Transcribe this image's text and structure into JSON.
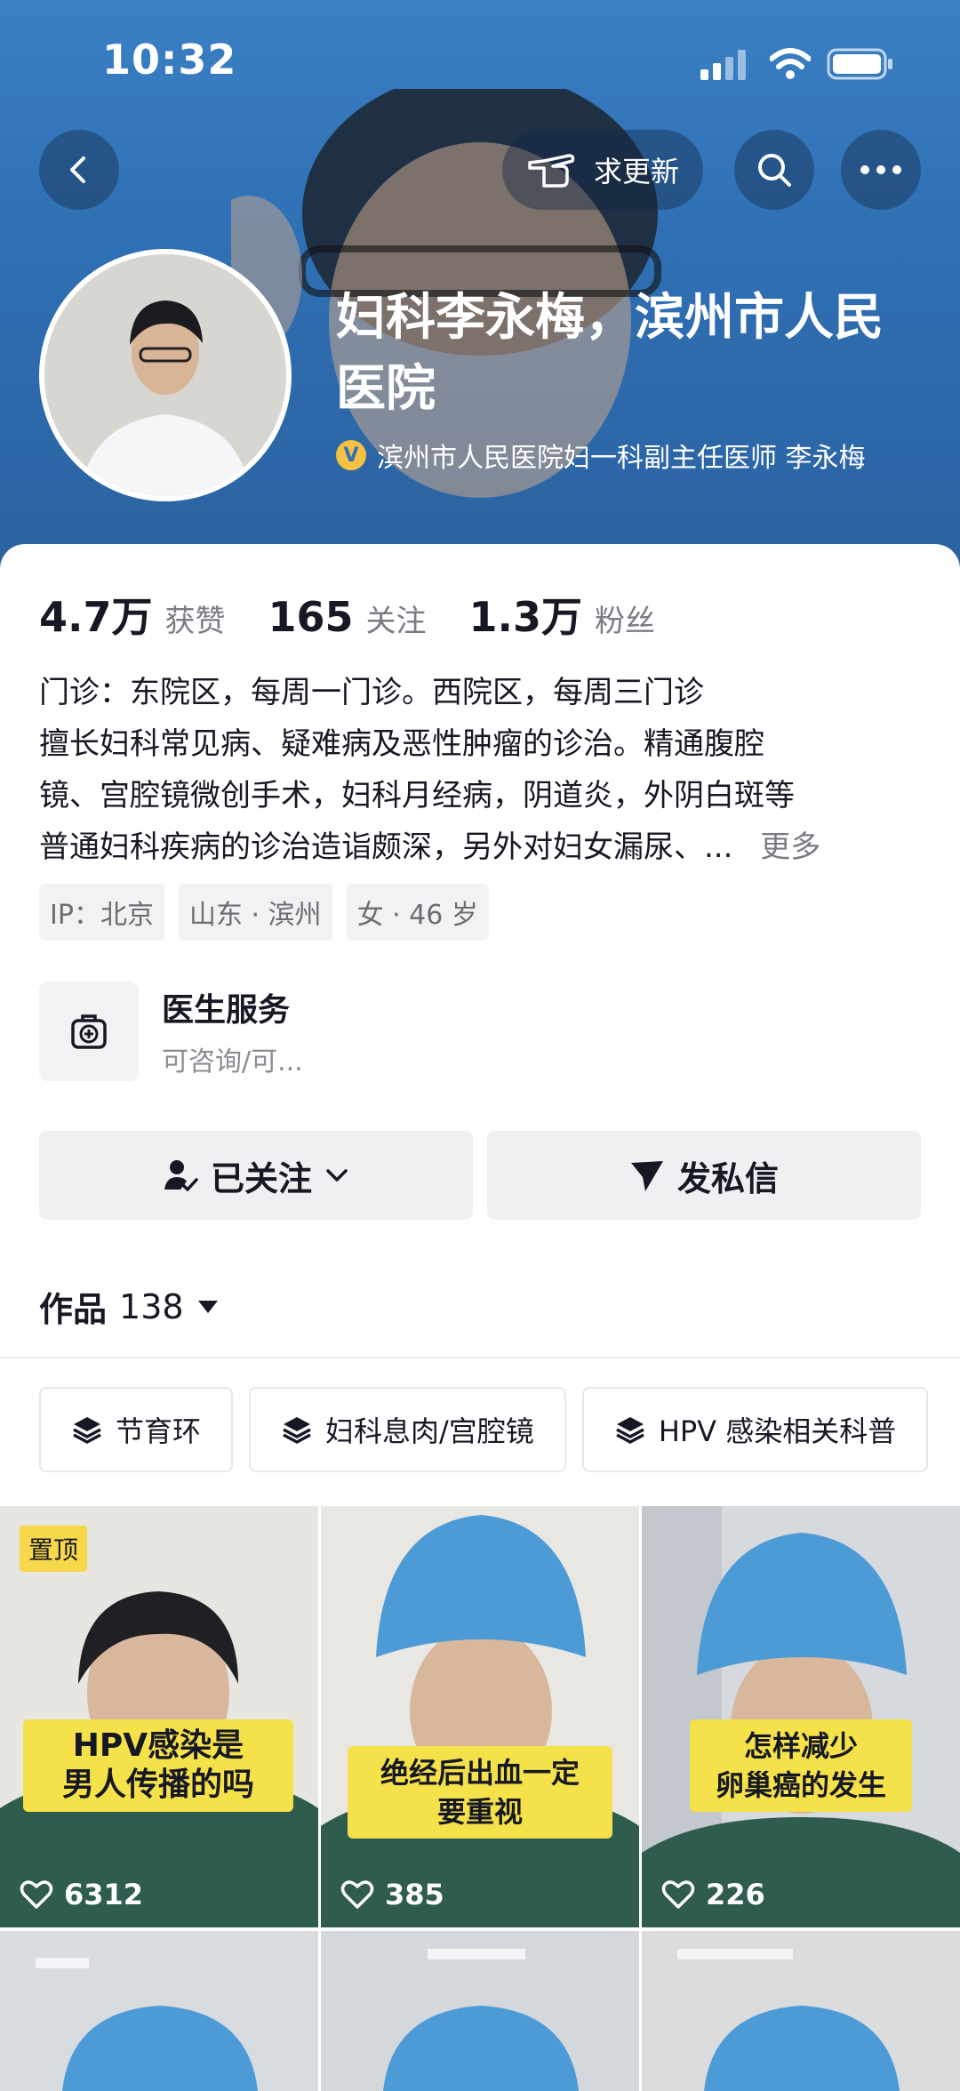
{
  "status_bar": {
    "time": "10:32"
  },
  "header": {
    "request_update_label": "求更新",
    "profile_name": "妇科李永梅，滨州市人民医院",
    "verification": "滨州市人民医院妇一科副主任医师 李永梅"
  },
  "stats": [
    {
      "value": "4.7万",
      "label": "获赞"
    },
    {
      "value": "165",
      "label": "关注"
    },
    {
      "value": "1.3万",
      "label": "粉丝"
    }
  ],
  "bio": {
    "lines": [
      "门诊：东院区，每周一门诊。西院区，每周三门诊",
      "擅长妇科常见病、疑难病及恶性肿瘤的诊治。精通腹腔",
      "镜、宫腔镜微创手术，妇科月经病，阴道炎，外阴白斑等",
      "普通妇科疾病的诊治造诣颇深，另外对妇女漏尿、..."
    ],
    "more_label": "更多"
  },
  "tags": [
    "IP：北京",
    "山东 · 滨州",
    "女 · 46 岁"
  ],
  "service": {
    "title": "医生服务",
    "subtitle": "可咨询/可..."
  },
  "actions": {
    "follow_label": "已关注",
    "message_label": "发私信"
  },
  "works": {
    "label": "作品",
    "count": "138"
  },
  "collections": [
    "节育环",
    "妇科息肉/宫腔镜",
    "HPV 感染相关科普"
  ],
  "videos": [
    {
      "pinned_label": "置顶",
      "caption": [
        "HPV感染是",
        "男人传播的吗"
      ],
      "likes": "6312"
    },
    {
      "caption": [
        "绝经后出血一定",
        "要重视"
      ],
      "likes": "385"
    },
    {
      "caption": [
        "怎样减少",
        "卵巢癌的发生"
      ],
      "likes": "226"
    }
  ],
  "colors": {
    "header_blue": "#2f6fb3",
    "caption_yellow": "#f5e14a",
    "pin_yellow": "#f7d84a",
    "text_primary": "#161823",
    "text_secondary": "#7a7c84"
  },
  "icons": [
    "back-icon",
    "point-hand-icon",
    "search-icon",
    "more-icon",
    "verified-icon",
    "medical-bag-icon",
    "user-check-icon",
    "chevron-down-icon",
    "send-icon",
    "caret-down-icon",
    "layers-icon",
    "heart-icon"
  ]
}
